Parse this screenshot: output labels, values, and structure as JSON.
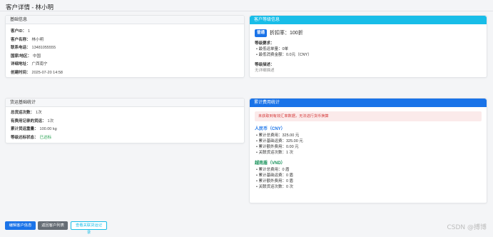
{
  "page": {
    "title": "客户详情 - 林小明"
  },
  "basic": {
    "header": "基础信息",
    "rows": [
      {
        "k": "客户ID：",
        "v": "1"
      },
      {
        "k": "客户名称：",
        "v": "林小明"
      },
      {
        "k": "联系电话：",
        "v": "13481055555"
      },
      {
        "k": "国家/地区：",
        "v": "中国"
      },
      {
        "k": "详细地址：",
        "v": "广西南宁"
      },
      {
        "k": "创建时间：",
        "v": "2025-07-20 14:58"
      }
    ]
  },
  "level": {
    "header": "客户等级信息",
    "badge": "普通",
    "discount": "折扣率：100折",
    "req_title": "等级要求：",
    "req_items": [
      "• 最低运单量：0单",
      "• 最低消费金额：0.0元（CNY）"
    ],
    "desc_title": "等级描述：",
    "desc": "无详细描述"
  },
  "shipping": {
    "header": "货运基础统计",
    "rows": [
      {
        "k": "总货运次数：",
        "v": "1次"
      },
      {
        "k": "有费用记录的货运：",
        "v": "1次"
      },
      {
        "k": "累计货运重量：",
        "v": "100.00 kg"
      },
      {
        "k": "等级达标状态：",
        "v": "已达标",
        "ok": true
      }
    ]
  },
  "fees": {
    "header": "累计费用统计",
    "alert": "未获取到有效汇率数据，无法进行货币换算",
    "cny": {
      "title": "人民币（CNY）",
      "items": [
        "• 累计总费用：325.00 元",
        "• 累计基础运费：325.00 元",
        "• 累计额外费用：0.00 元",
        "• 关联货运次数：1 次"
      ]
    },
    "vnd": {
      "title": "越南盾（VND）",
      "items": [
        "• 累计总费用：0 盾",
        "• 累计基础运费：0 盾",
        "• 累计额外费用：0 盾",
        "• 关联货运次数：0 次"
      ]
    }
  },
  "buttons": {
    "edit": "编辑客户信息",
    "back": "返回客户列表",
    "records": "查看关联货运记录"
  },
  "watermark": "CSDN @搏博"
}
